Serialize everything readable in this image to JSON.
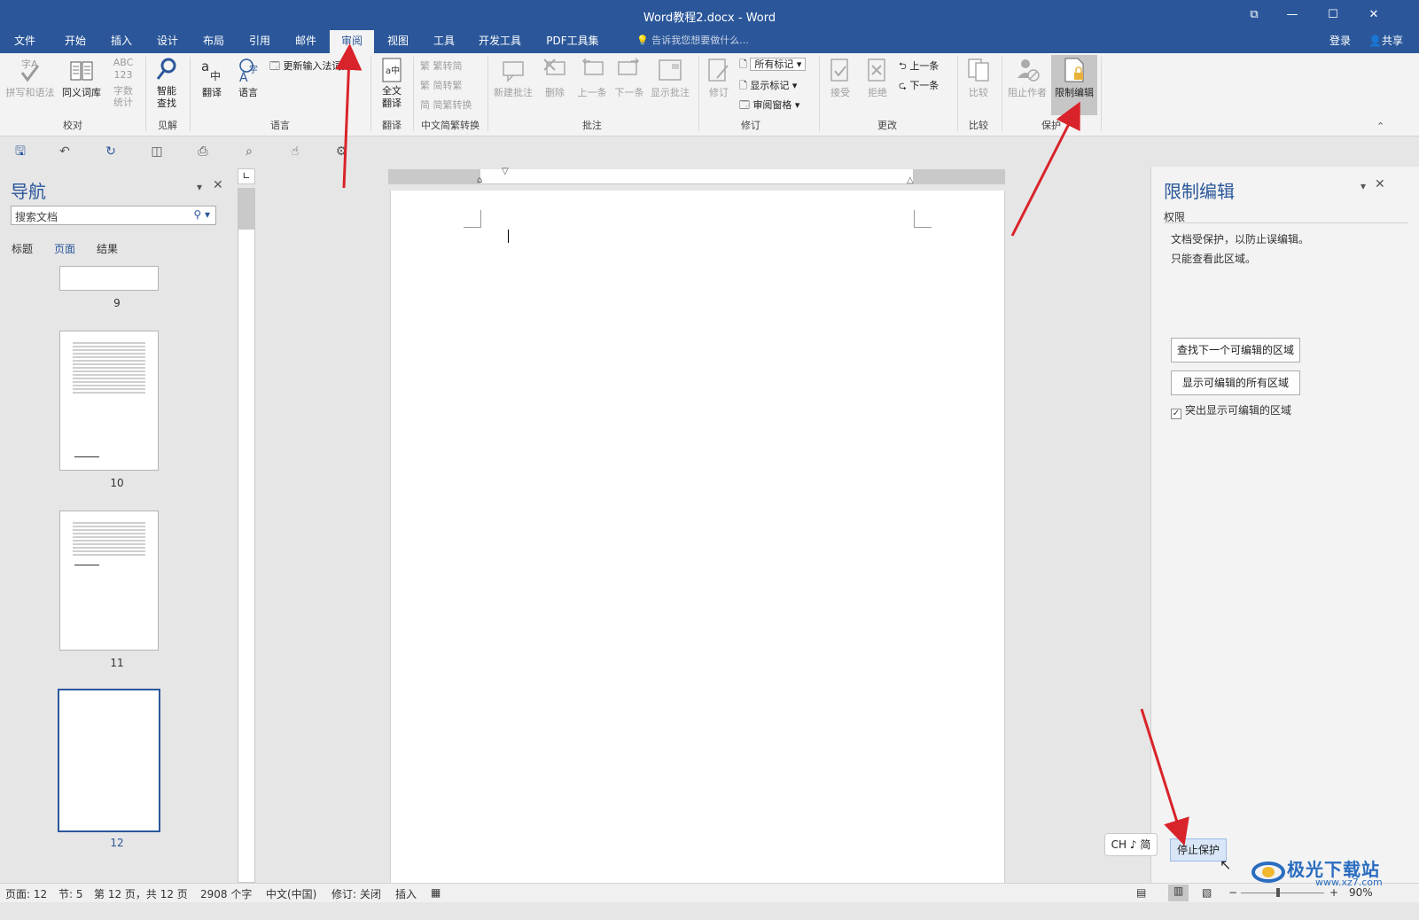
{
  "window": {
    "title": "Word教程2.docx - Word"
  },
  "tabs": [
    "文件",
    "开始",
    "插入",
    "设计",
    "布局",
    "引用",
    "邮件",
    "审阅",
    "视图",
    "工具",
    "开发工具",
    "PDF工具集"
  ],
  "active_tab": "审阅",
  "tell_me": "告诉我您想要做什么...",
  "login": "登录",
  "share": "共享",
  "ribbon": {
    "proofing": {
      "spell": "拼写和语法",
      "thesaurus": "同义词库",
      "wordcount_icon": "ABC 123",
      "wordcount": "字数统计",
      "label": "校对"
    },
    "insights": {
      "smart_lookup": "智能查找",
      "label": "见解"
    },
    "language": {
      "translate": "翻译",
      "language": "语言",
      "update_ime": "更新输入法词典",
      "label": "语言"
    },
    "translation": {
      "full_translate": "全文翻译",
      "label": "翻译"
    },
    "chinese": {
      "t2s": "繁转简",
      "s2t": "简转繁",
      "convert": "简繁转换",
      "label": "中文简繁转换"
    },
    "comments": {
      "new": "新建批注",
      "delete": "删除",
      "prev": "上一条",
      "next": "下一条",
      "show": "显示批注",
      "label": "批注"
    },
    "tracking": {
      "track": "修订",
      "all_markup": "所有标记",
      "show_markup": "显示标记",
      "review_pane": "审阅窗格",
      "label": "修订"
    },
    "changes": {
      "accept": "接受",
      "reject": "拒绝",
      "prev": "上一条",
      "next": "下一条",
      "label": "更改"
    },
    "compare": {
      "compare": "比较",
      "label": "比较"
    },
    "protect": {
      "block_authors": "阻止作者",
      "restrict_editing": "限制编辑",
      "label": "保护"
    }
  },
  "nav": {
    "title": "导航",
    "search_placeholder": "搜索文档",
    "tabs": [
      "标题",
      "页面",
      "结果"
    ],
    "active_tab": "页面",
    "pages": [
      "9",
      "10",
      "11",
      "12"
    ],
    "selected_page": "12"
  },
  "restrict_pane": {
    "title": "限制编辑",
    "section": "权限",
    "message1": "文档受保护，以防止误编辑。",
    "message2": "只能查看此区域。",
    "find_next_btn": "查找下一个可编辑的区域",
    "show_all_btn": "显示可编辑的所有区域",
    "highlight_label": "突出显示可编辑的区域",
    "highlight_checked": true,
    "stop_btn": "停止保护"
  },
  "ime": {
    "label": "CH ♪ 简"
  },
  "status": {
    "page": "页面: 12",
    "section": "节: 5",
    "pages": "第 12 页，共 12 页",
    "words": "2908 个字",
    "lang": "中文(中国)",
    "track": "修订: 关闭",
    "insert": "插入",
    "zoom": "90%"
  },
  "watermark": {
    "line1": "极光下载站",
    "line2": "www.xz7.com"
  },
  "colors": {
    "accent": "#2b579a",
    "arrow": "#d9232a"
  }
}
